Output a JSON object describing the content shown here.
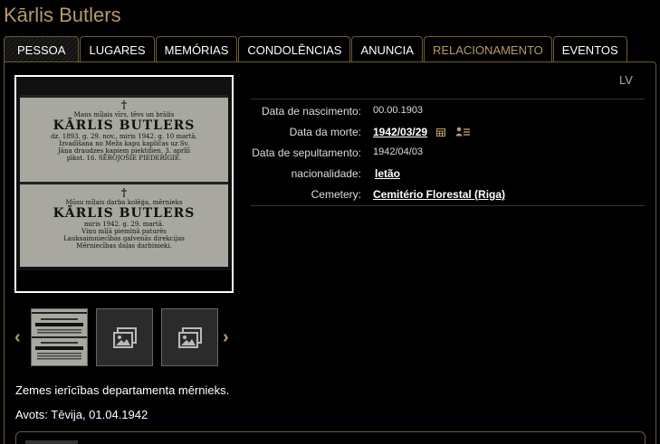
{
  "person": {
    "name": "Kārlis Butlers"
  },
  "tabs": [
    {
      "label": "PESSOA"
    },
    {
      "label": "LUGARES"
    },
    {
      "label": "MEMÓRIAS"
    },
    {
      "label": "CONDOLÊNCIAS"
    },
    {
      "label": "ANUNCIA"
    },
    {
      "label": "RELACIONAMENTO"
    },
    {
      "label": "EVENTOS"
    }
  ],
  "lang": "LV",
  "details": {
    "birth": {
      "label": "Data de nascimento:",
      "value": "00.00.1903"
    },
    "death": {
      "label": "Data da morte:",
      "value": "1942/03/29"
    },
    "burial": {
      "label": "Data de sepultamento:",
      "value": "1942/04/03"
    },
    "nationality": {
      "label": "nacionalidade:",
      "value": "letão"
    },
    "cemetery": {
      "label": "Cemetery:",
      "value": "Cemitério Florestal (Riga)"
    }
  },
  "clipping": {
    "top": {
      "cross": "†",
      "intro": "Mans mīļais vīrs, tēvs un brālis",
      "name": "KĀRLIS BUTLERS",
      "text1": "dz. 1893. g. 29. nov., miris 1942. g. 10 martā.",
      "text2": "Izvadīšana no Meža kapu kapličas uz Sv.",
      "text3": "Jāņa draudzes kapiem piektdien, 3. aprīlī",
      "text4": "pīkst. 16. SĒROJOŠIE PIEDERĪGIE."
    },
    "bottom": {
      "cross": "†",
      "intro": "Mūsu mīļais darba kolēģa, mērnieks",
      "name": "KĀRLIS BUTLERS",
      "text1": "miris 1942. g. 29. martā.",
      "text2": "Viņu mīļā piemiņā paturēs",
      "text3": "Lauksaimniecības galvenās direkcijas",
      "text4": "Mērniecības daļas darbinieki."
    }
  },
  "description": "Zemes ierīcības departamenta mērnieks.",
  "source": "Avots: Tēvija, 01.04.1942"
}
